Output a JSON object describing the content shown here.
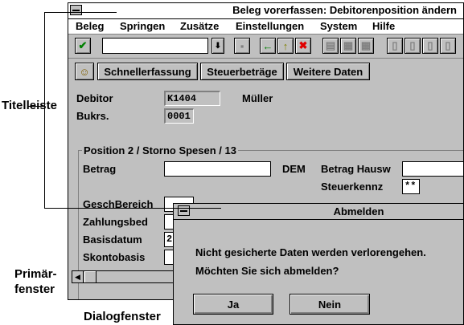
{
  "window": {
    "title": "Beleg vorerfassen: Debitorenposition ändern",
    "menu": [
      "Beleg",
      "Springen",
      "Zusätze",
      "Einstellungen",
      "System",
      "Hilfe"
    ],
    "toolbar": {
      "dropdown_icon": "⬇",
      "check_icon": "✔",
      "back_icon": "←",
      "up_icon": "↑",
      "cancel_icon": "✖"
    },
    "app_buttons": [
      "Schnellerfassung",
      "Steuerbeträge",
      "Weitere Daten"
    ],
    "header_fields": {
      "debitor_label": "Debitor",
      "debitor_value": "K1404",
      "debitor_name": "Müller",
      "bukrs_label": "Bukrs.",
      "bukrs_value": "0001"
    },
    "group": {
      "title": "Position 2 / Storno Spesen / 13",
      "betrag_label": "Betrag",
      "currency": "DEM",
      "betrag_hausw_label": "Betrag Hausw",
      "steuerkennz_label": "Steuerkennz",
      "steuerkennz_value": "**",
      "geschbereich_label": "GeschBereich",
      "zahlungsbed_label": "Zahlungsbed",
      "basisdatum_label": "Basisdatum",
      "basisdatum_value": "2",
      "skontobasis_label": "Skontobasis"
    }
  },
  "dialog": {
    "title": "Abmelden",
    "line1": "Nicht gesicherte Daten werden verlorengehen.",
    "line2": "Möchten Sie sich abmelden?",
    "yes_label": "Ja",
    "no_label": "Nein"
  },
  "callouts": {
    "titelleiste": "Titelleiste",
    "primaer_1": "Primär-",
    "primaer_2": "fenster",
    "dialogfenster": "Dialogfenster"
  }
}
